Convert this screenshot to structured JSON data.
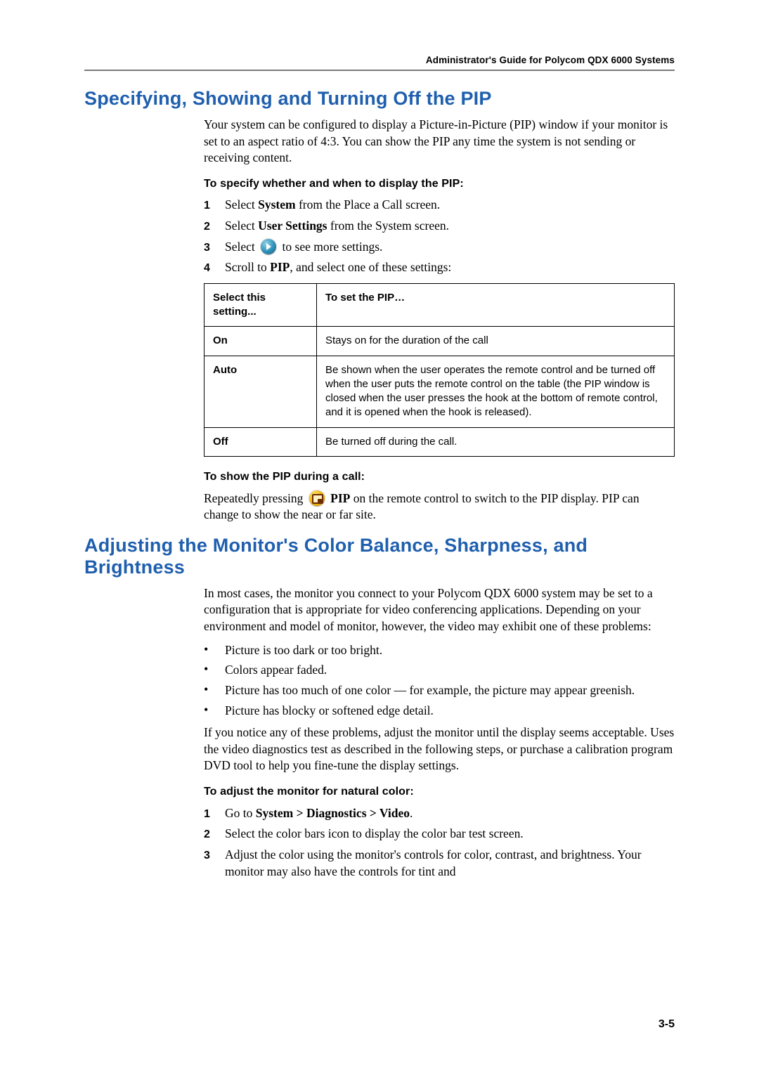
{
  "running_head": "Administrator's Guide for Polycom QDX 6000 Systems",
  "section1": {
    "title": "Specifying, Showing and Turning Off the PIP",
    "intro": "Your system can be configured to display a Picture-in-Picture (PIP) window if your monitor is set to an aspect ratio of 4:3. You can show the PIP any time the system is not sending or receiving content.",
    "sub1": "To specify whether and when to display the PIP:",
    "steps": [
      {
        "n": "1",
        "pre": "Select ",
        "b": "System",
        "post": " from the Place a Call screen."
      },
      {
        "n": "2",
        "pre": "Select ",
        "b": "User Settings",
        "post": " from the System screen."
      },
      {
        "n": "3",
        "pre": "Select ",
        "icon": "next",
        "post": " to see more settings."
      },
      {
        "n": "4",
        "pre": "Scroll to ",
        "b": "PIP",
        "post": ", and select one of these settings:"
      }
    ],
    "table": {
      "head": [
        "Select this setting...",
        "To set the PIP…"
      ],
      "rows": [
        [
          "On",
          "Stays on for the duration of the call"
        ],
        [
          "Auto",
          "Be shown when the user operates the remote control and be turned off when the user puts the remote control on the table (the PIP window is closed when the user presses the hook at the bottom of remote control, and it is opened when the hook is released)."
        ],
        [
          "Off",
          "Be turned off during the call."
        ]
      ]
    },
    "sub2": "To show the PIP during a call:",
    "showpip": {
      "pre": "Repeatedly pressing ",
      "bold": "PIP",
      "mid": " on the remote control to switch to the PIP display. PIP can change to show the near or far site."
    }
  },
  "section2": {
    "title": "Adjusting the Monitor's Color Balance, Sharpness, and Brightness",
    "intro": "In most cases, the monitor you connect to your Polycom QDX 6000 system may be set to a configuration that is appropriate for video conferencing applications. Depending on your environment and model of monitor, however, the video may exhibit one of these problems:",
    "bullets": [
      "Picture is too dark or too bright.",
      "Colors appear faded.",
      "Picture has too much of one color — for example, the picture may appear greenish.",
      "Picture has blocky or softened edge detail."
    ],
    "after_bullets": "If you notice any of these problems, adjust the monitor until the display seems acceptable. Uses the video diagnostics test as described in the following steps, or purchase a calibration program DVD tool to help you fine-tune the display settings.",
    "sub1": "To adjust the monitor for natural color:",
    "steps": [
      {
        "n": "1",
        "pre": "Go to ",
        "b": "System > Diagnostics > Video",
        "post": "."
      },
      {
        "n": "2",
        "pre": "Select the color bars icon to display the color bar test screen.",
        "b": "",
        "post": ""
      },
      {
        "n": "3",
        "pre": "Adjust the color using the monitor's controls for color, contrast, and brightness. Your monitor may also have the controls for tint and",
        "b": "",
        "post": ""
      }
    ]
  },
  "page_number": "3-5"
}
